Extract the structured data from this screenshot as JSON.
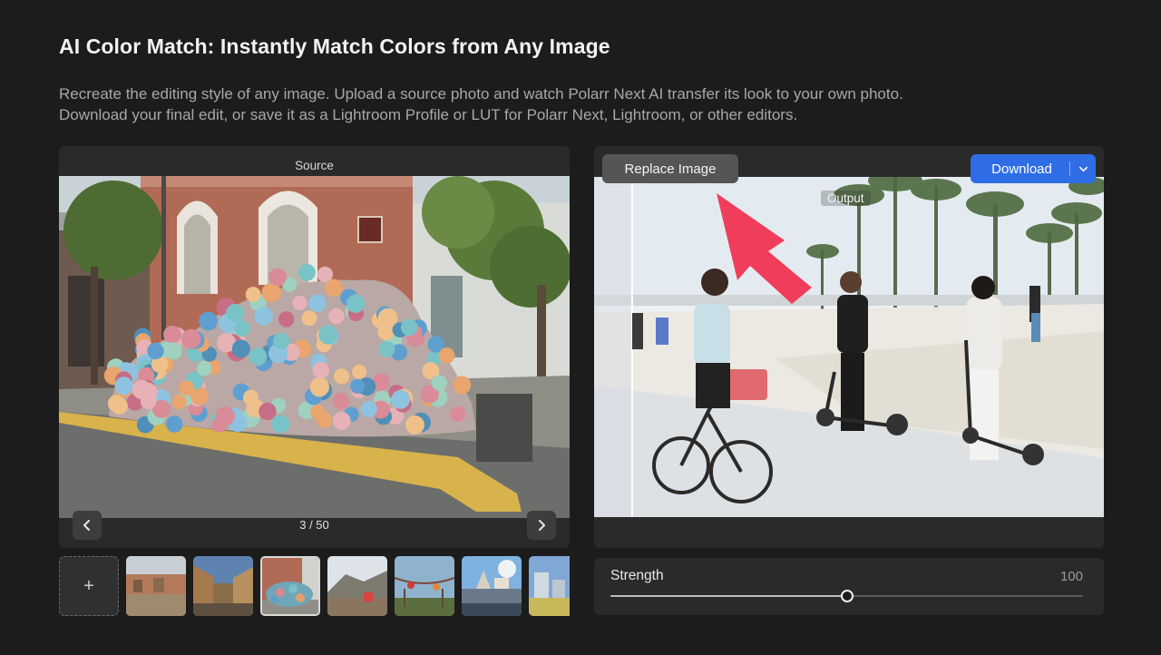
{
  "header": {
    "title": "AI Color Match: Instantly Match Colors from Any Image",
    "description_line1": "Recreate the editing style of any image. Upload a source photo and watch Polarr Next AI transfer its look to your own photo.",
    "description_line2": "Download your final edit, or save it as a Lightroom Profile or LUT for Polarr Next, Lightroom, or other editors."
  },
  "source": {
    "label": "Source",
    "counter": "3 / 50",
    "prev_icon": "chevron-left-icon",
    "next_icon": "chevron-right-icon"
  },
  "thumbnails": {
    "add_label": "+",
    "items": [
      "thumb-1",
      "thumb-2",
      "thumb-3",
      "thumb-4",
      "thumb-5",
      "thumb-6",
      "thumb-7"
    ],
    "selected_index": 2
  },
  "output": {
    "label": "Output",
    "replace_label": "Replace Image",
    "download_label": "Download",
    "download_icon": "chevron-down-icon"
  },
  "strength": {
    "label": "Strength",
    "value": "100",
    "slider_fraction": 0.5
  },
  "colors": {
    "background": "#1c1c1c",
    "panel": "#2a2a2a",
    "accent": "#2f6de6",
    "arrow": "#ef3d5b"
  }
}
